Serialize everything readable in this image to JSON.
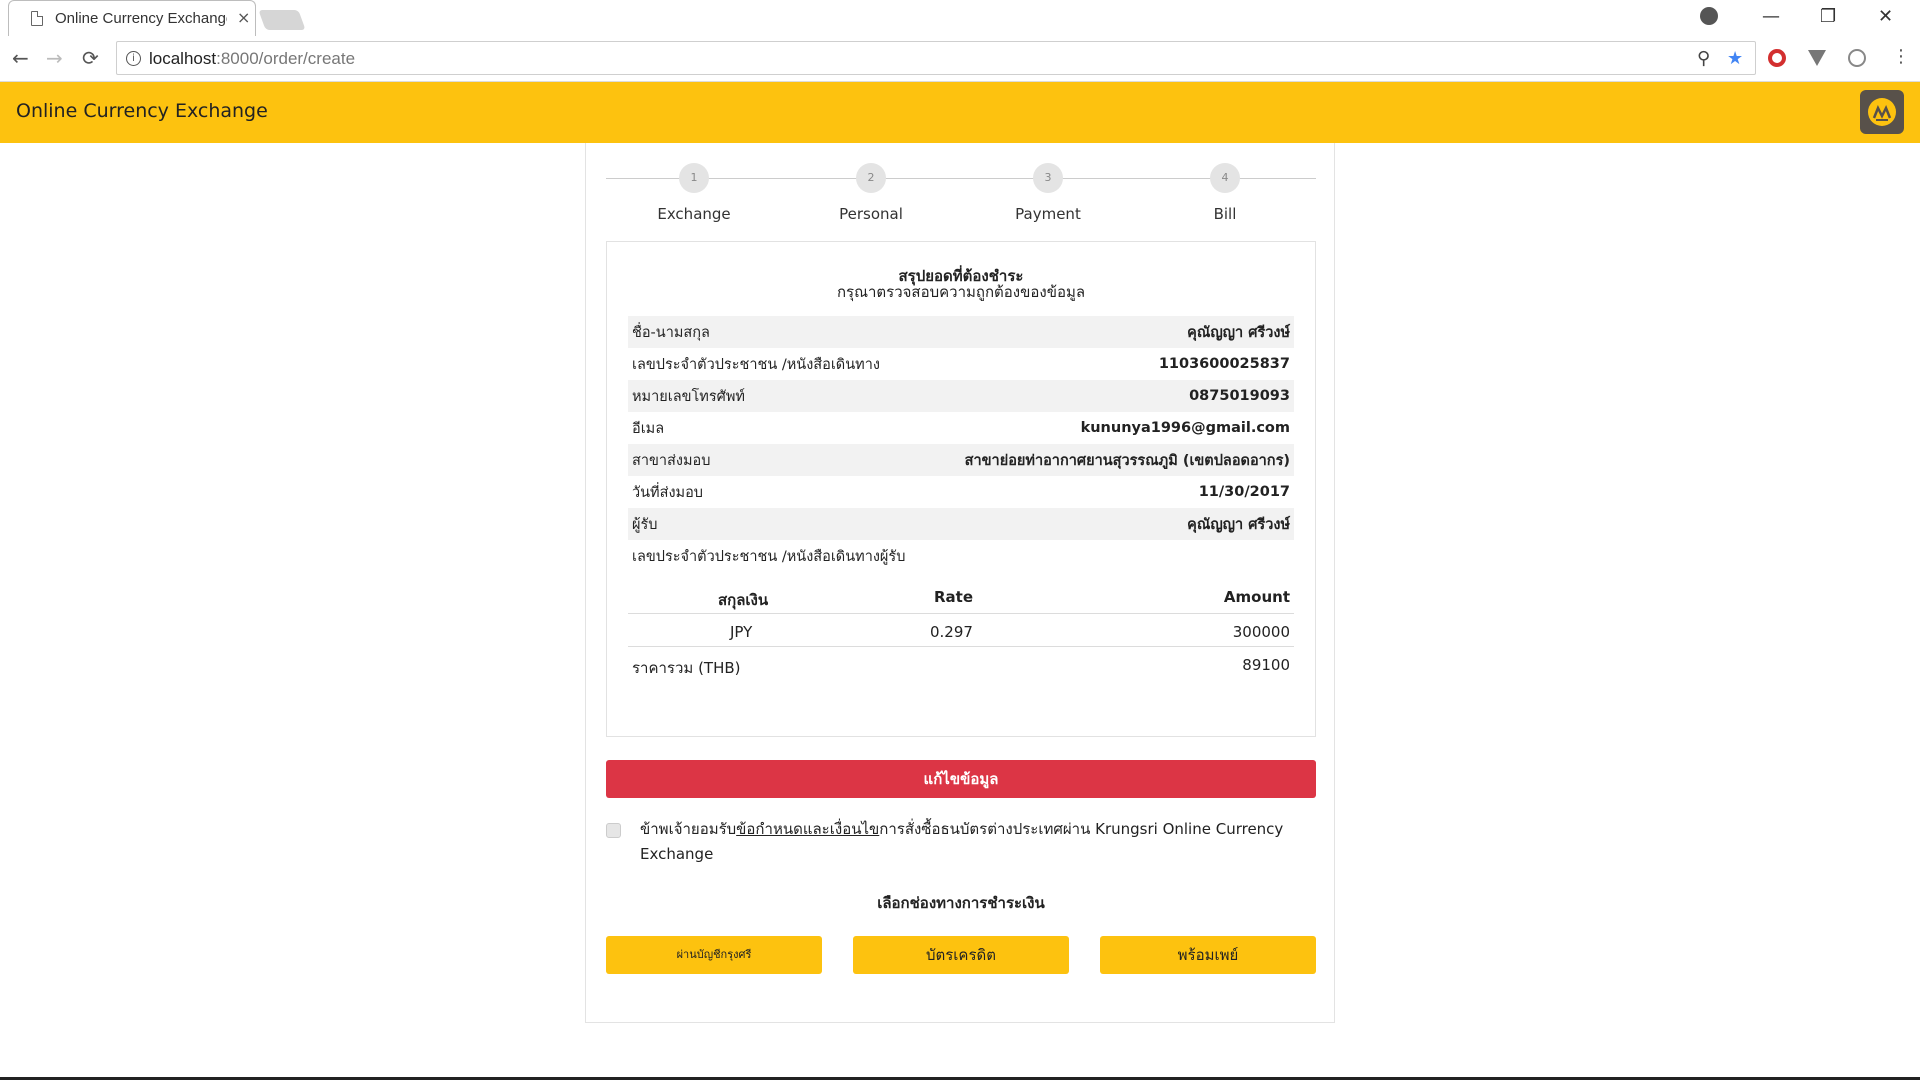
{
  "browser": {
    "tab_title": "Online Currency Exchange",
    "tab_close": "×",
    "url_host": "localhost",
    "url_path": ":8000/order/create",
    "nav": {
      "back": "←",
      "forward": "→",
      "reload": "⟳"
    },
    "window_controls": {
      "minimize": "—",
      "restore": "❐",
      "close": "✕"
    },
    "omnibox_icons": {
      "zoom": "⚲",
      "bookmark": "★"
    }
  },
  "header": {
    "title": "Online Currency Exchange"
  },
  "steps": [
    {
      "num": "1",
      "label": "Exchange"
    },
    {
      "num": "2",
      "label": "Personal"
    },
    {
      "num": "3",
      "label": "Payment"
    },
    {
      "num": "4",
      "label": "Bill"
    }
  ],
  "summary": {
    "title": "สรุปยอดที่ต้องชำระ",
    "subtitle": "กรุณาตรวจสอบความถูกต้องของข้อมูล",
    "rows": [
      {
        "label": "ชื่อ-นามสกุล",
        "value": "คุณัญญา ศรีวงษ์"
      },
      {
        "label": "เลขประจำตัวประชาชน /หนังสือเดินทาง",
        "value": "1103600025837"
      },
      {
        "label": "หมายเลขโทรศัพท์",
        "value": "0875019093"
      },
      {
        "label": "อีเมล",
        "value": "kununya1996@gmail.com"
      },
      {
        "label": "สาขาส่งมอบ",
        "value": "สาขาย่อยท่าอากาศยานสุวรรณภูมิ (เขตปลอดอากร)"
      },
      {
        "label": "วันที่ส่งมอบ",
        "value": "11/30/2017"
      },
      {
        "label": "ผู้รับ",
        "value": "คุณัญญา ศรีวงษ์"
      },
      {
        "label": "เลขประจำตัวประชาชน /หนังสือเดินทางผู้รับ",
        "value": ""
      }
    ],
    "currency_table": {
      "headers": {
        "currency": "สกุลเงิน",
        "rate": "Rate",
        "amount": "Amount"
      },
      "row": {
        "currency": "JPY",
        "rate": "0.297",
        "amount": "300000"
      },
      "total_label": "ราคารวม (THB)",
      "total_value": "89100"
    }
  },
  "edit_button": "แก้ไขข้อมูล",
  "agreement": {
    "prefix": "ข้าพเจ้ายอมรับ",
    "link": "ข้อกำหนดและเงื่อนไข",
    "suffix": "การสั่งซื้อธนบัตรต่างประเทศผ่าน Krungsri Online Currency Exchange"
  },
  "payment": {
    "title": "เลือกช่องทางการชำระเงิน",
    "options": [
      "ผ่านบัญชีกรุงศรี",
      "บัตรเครดิต",
      "พร้อมเพย์"
    ]
  }
}
